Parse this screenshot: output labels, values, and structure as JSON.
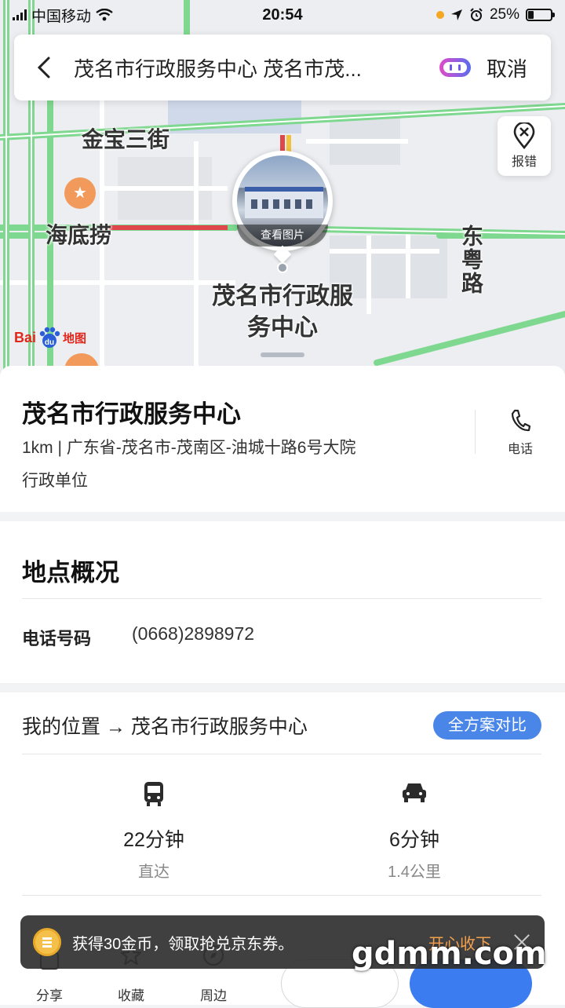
{
  "status_bar": {
    "carrier": "中国移动",
    "time": "20:54",
    "battery": "25%"
  },
  "search": {
    "query": "茂名市行政服务中心 茂名市茂...",
    "cancel_label": "取消"
  },
  "map": {
    "labels": {
      "street_1": "金宝三街",
      "restaurant": "海底捞",
      "road_east": "东粤路",
      "poi": "茂名市行政服务中心"
    },
    "photo_caption": "查看图片",
    "report_label": "报错",
    "logo_text": "Bai",
    "logo_du": "du",
    "logo_suffix": "地图"
  },
  "place": {
    "name": "茂名市行政服务中心",
    "address": "1km | 广东省-茂名市-茂南区-油城十路6号大院",
    "category": "行政单位",
    "call_label": "电话"
  },
  "overview": {
    "title": "地点概况",
    "phone_label": "电话号码",
    "phone_value": "(0668)2898972"
  },
  "route": {
    "title": "我的位置 → 茂名市行政服务中心",
    "compare_label": "全方案对比",
    "bus": {
      "time": "22分钟",
      "sub": "直达"
    },
    "car": {
      "time": "6分钟",
      "sub": "1.4公里"
    }
  },
  "bottom_bar": {
    "share": "分享",
    "favorite": "收藏",
    "nearby": "周边"
  },
  "toast": {
    "text": "获得30金币，领取抢兑京东券。",
    "action": "开心收下"
  },
  "watermark": "gdmm.com",
  "colors": {
    "accent_blue": "#4a86e8",
    "road_green": "#7fd88f",
    "road_red": "#e0474c",
    "toast_action": "#f5a04a"
  }
}
